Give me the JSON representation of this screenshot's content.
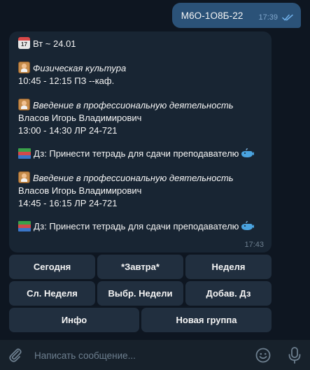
{
  "outgoing": {
    "text": "М6О-1О8Б-22",
    "time": "17:39"
  },
  "incoming": {
    "header_date": "Вт ~ 24.01",
    "time": "17:43",
    "lesson1": {
      "title": "Физическая культура",
      "schedule": "10:45 - 12:15   ПЗ   --каф."
    },
    "lesson2": {
      "title": "Введение в профессиональную деятельность",
      "teacher": "Власов Игорь Владимирович",
      "schedule": "13:00 - 14:30   ЛР   24-721",
      "homework": "Дз: Принести тетрадь для сдачи преподавателю"
    },
    "lesson3": {
      "title": "Введение в профессиональную деятельность",
      "teacher": "Власов Игорь Владимирович",
      "schedule": "14:45 - 16:15   ЛР   24-721",
      "homework": "Дз: Принести тетрадь для сдачи преподавателю"
    }
  },
  "keyboard": {
    "row1": [
      "Сегодня",
      "*Завтра*",
      "Неделя"
    ],
    "row2": [
      "Сл. Неделя",
      "Выбр. Недели",
      "Добав. Дз"
    ],
    "row3": [
      "Инфо",
      "Новая группа"
    ]
  },
  "composer": {
    "placeholder": "Написать сообщение..."
  },
  "colors": {
    "background": "#0e1621",
    "outgoing_bubble": "#2b5278",
    "incoming_bubble": "#182533",
    "keyboard_button": "#212f3f",
    "composer": "#17212b",
    "read_check": "#6fb0ea"
  },
  "icons": {
    "date": "calendar-icon",
    "lesson": "teacher-icon",
    "homework": "books-icon",
    "homework_suffix": "whale-icon",
    "read_status": "double-check-icon",
    "attach": "paperclip-icon",
    "emoji": "emoji-icon",
    "voice": "microphone-icon"
  }
}
